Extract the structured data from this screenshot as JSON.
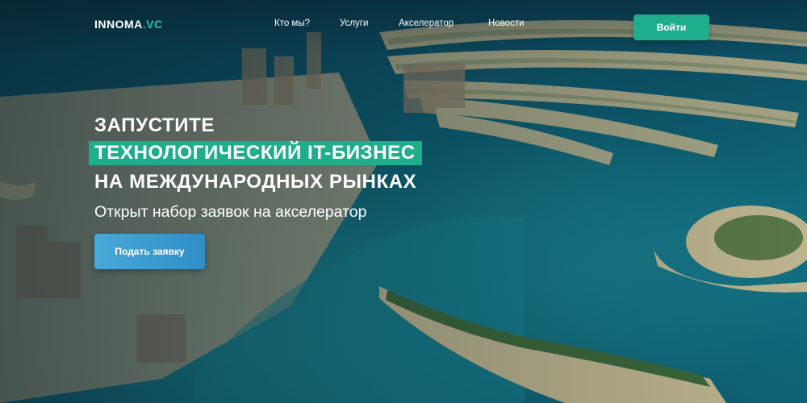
{
  "header": {
    "logo_main": "INNOMA",
    "logo_dot": ".",
    "logo_suffix": "VC",
    "nav": [
      {
        "label": "Кто мы?"
      },
      {
        "label": "Услуги"
      },
      {
        "label": "Акселератор"
      },
      {
        "label": "Новости"
      }
    ],
    "login_label": "Войти"
  },
  "hero": {
    "line1": "ЗАПУСТИТЕ",
    "line2": "ТЕХНОЛОГИЧЕСКИЙ IT-БИЗНЕС",
    "line3": "НА МЕЖДУНАРОДНЫХ РЫНКАХ",
    "subtitle": "Открыт набор заявок на акселератор",
    "cta_label": "Подать заявку"
  },
  "colors": {
    "accent_green": "#1fae8c",
    "cta_blue": "#3b9bd0",
    "text": "#ffffff"
  }
}
